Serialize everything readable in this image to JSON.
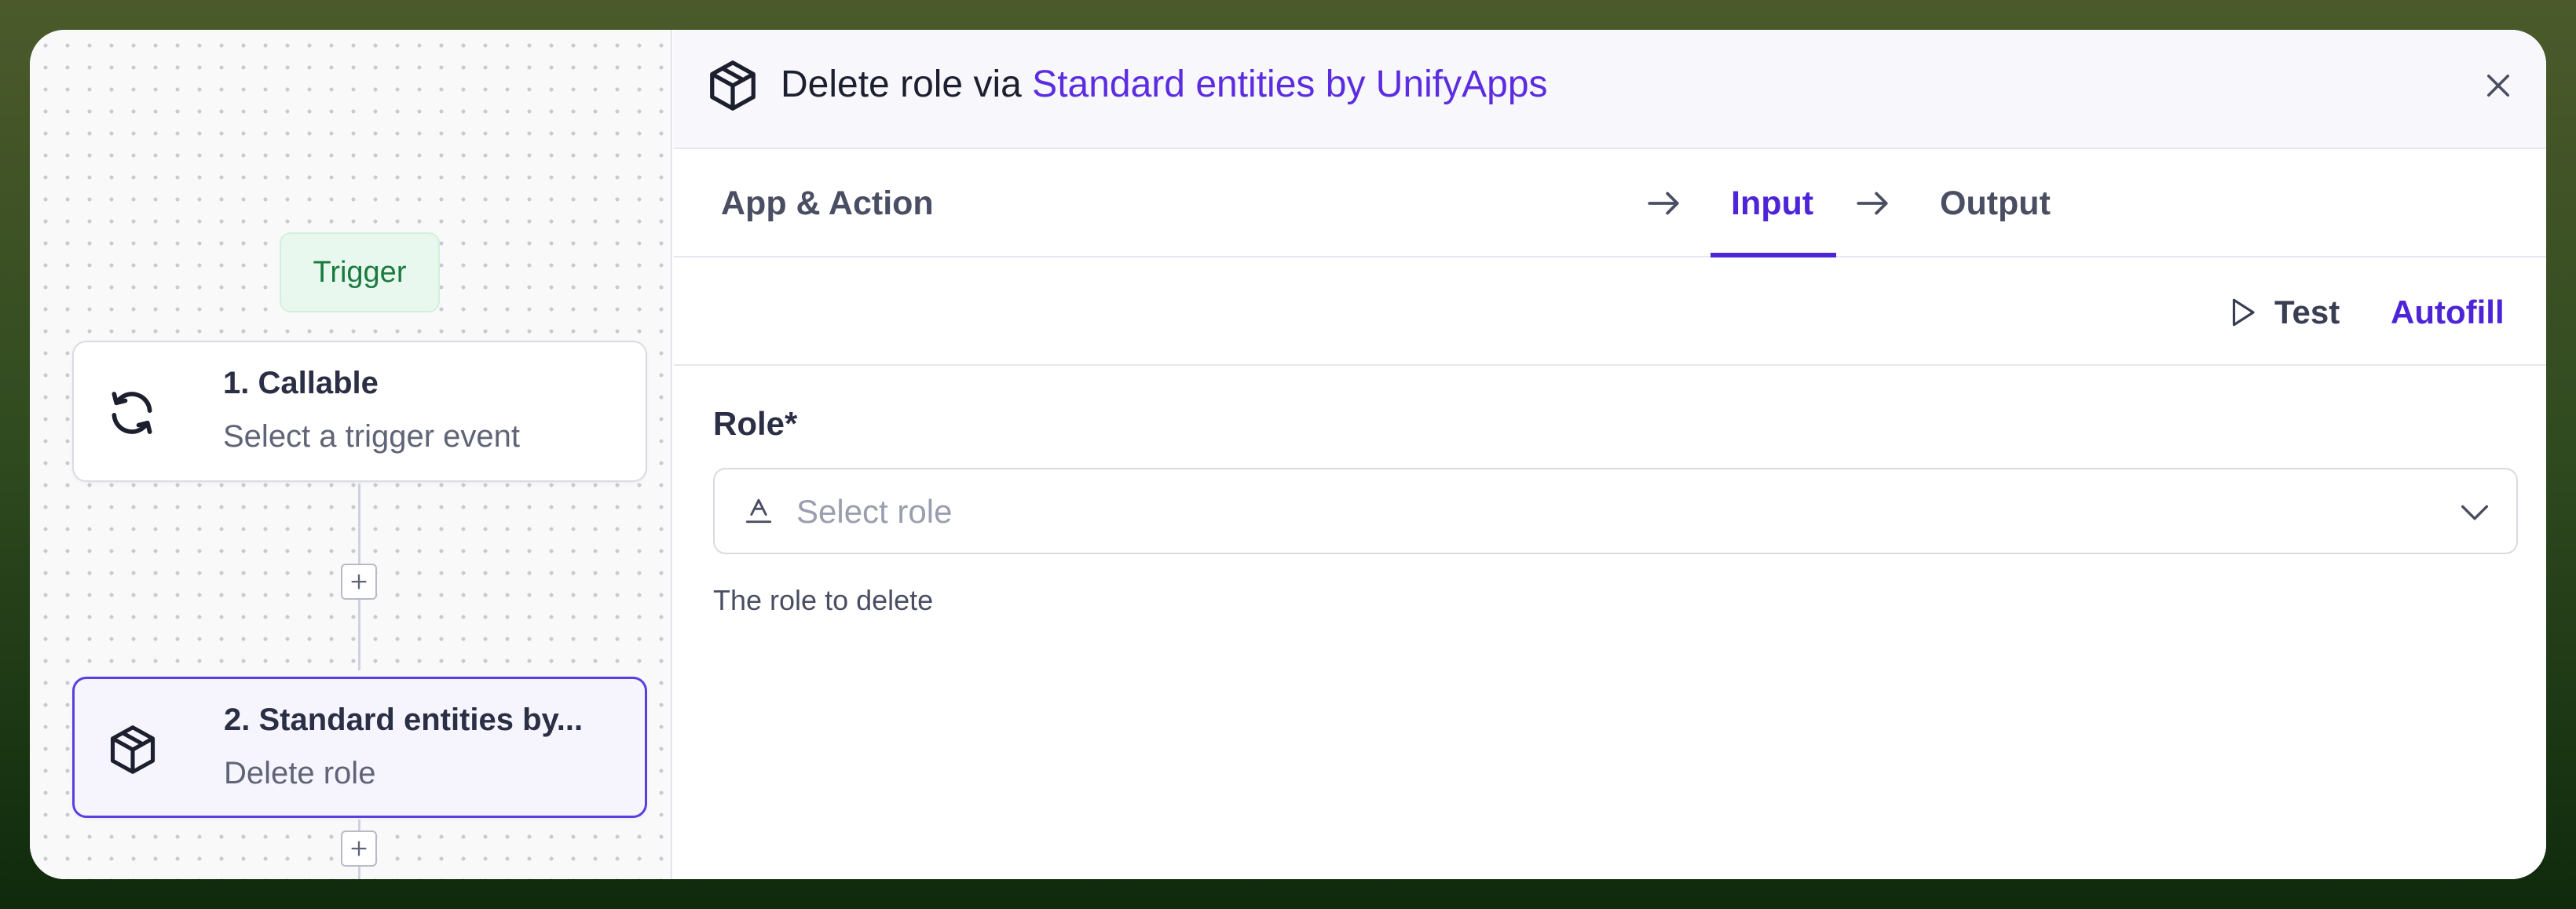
{
  "flow": {
    "trigger_label": "Trigger",
    "nodes": [
      {
        "title": "1. Callable",
        "subtitle": "Select a trigger event",
        "icon": "refresh-icon"
      },
      {
        "title": "2. Standard entities by...",
        "subtitle": "Delete role",
        "icon": "package-icon"
      }
    ]
  },
  "panel": {
    "title_prefix": "Delete role via",
    "title_app": "Standard entities by UnifyApps",
    "tabs": [
      "App & Action",
      "Input",
      "Output"
    ],
    "active_tab": "Input",
    "toolbar": {
      "test_label": "Test",
      "autofill_label": "Autofill"
    },
    "field": {
      "label": "Role*",
      "placeholder": "Select role",
      "help": "The role to delete"
    }
  },
  "colors": {
    "accent": "#4d24d8",
    "trigger_green": "#1b7a3e"
  }
}
